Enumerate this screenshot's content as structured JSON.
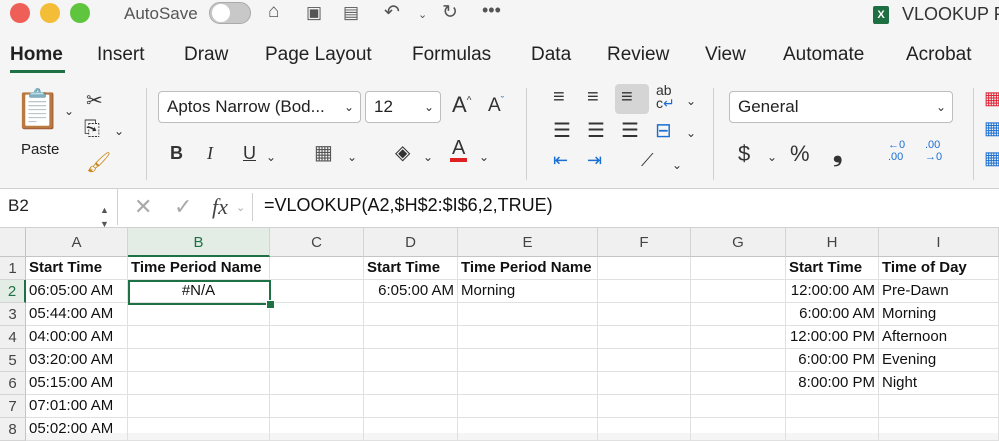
{
  "titlebar": {
    "autosave_label": "AutoSave",
    "doc_icon": "X",
    "doc_title": "VLOOKUP P",
    "icons": [
      "home-icon",
      "save-icon",
      "save-as-icon",
      "undo-icon",
      "redo-icon",
      "more-icon"
    ]
  },
  "tabs": [
    "Home",
    "Insert",
    "Draw",
    "Page Layout",
    "Formulas",
    "Data",
    "Review",
    "View",
    "Automate",
    "Acrobat"
  ],
  "ribbon": {
    "paste_label": "Paste",
    "font_name": "Aptos Narrow (Bod...",
    "font_size": "12",
    "bold": "B",
    "italic": "I",
    "underline": "U",
    "number_format": "General",
    "currency": "$",
    "percent": "%",
    "comma": "❟",
    "inc_decimal": "←0\n.00",
    "dec_decimal": ".00\n→0",
    "grow_font": "A^",
    "shrink_font": "Aˇ",
    "wrap_text": "ab\nc",
    "accent_font_color": "#e02020"
  },
  "formula_bar": {
    "name_box": "B2",
    "fx": "fx",
    "formula": "=VLOOKUP(A2,$H$2:$I$6,2,TRUE)"
  },
  "grid": {
    "columns": [
      "A",
      "B",
      "C",
      "D",
      "E",
      "F",
      "G",
      "H",
      "I"
    ],
    "rows": [
      "1",
      "2",
      "3",
      "4",
      "5",
      "6",
      "7",
      "8"
    ],
    "selected_cell": "B2",
    "cells": {
      "A1": "Start Time",
      "B1": "Time Period Name",
      "D1": "Start Time",
      "E1": "Time Period Name",
      "H1": "Start Time",
      "I1": "Time of Day",
      "A2": "06:05:00 AM",
      "B2": "#N/A",
      "D2": "6:05:00 AM",
      "E2": "Morning",
      "H2": "12:00:00 AM",
      "I2": "Pre-Dawn",
      "A3": "05:44:00 AM",
      "H3": "6:00:00 AM",
      "I3": "Morning",
      "A4": "04:00:00 AM",
      "H4": "12:00:00 PM",
      "I4": "Afternoon",
      "A5": "03:20:00 AM",
      "H5": "6:00:00 PM",
      "I5": "Evening",
      "A6": "05:15:00 AM",
      "H6": "8:00:00 PM",
      "I6": "Night",
      "A7": "07:01:00 AM",
      "A8": "05:02:00 AM"
    }
  }
}
